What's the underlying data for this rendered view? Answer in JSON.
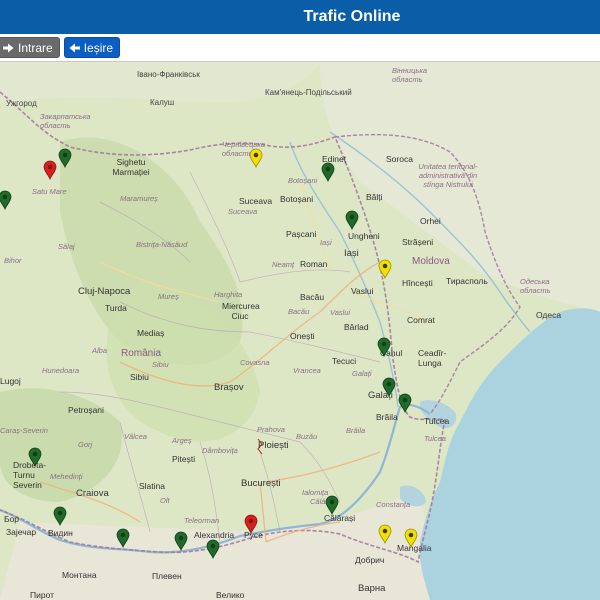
{
  "header": {
    "title": "Trafic Online"
  },
  "toolbar": {
    "login_label": "Intrare",
    "logout_label": "Ieșire"
  },
  "colors": {
    "header": "#0a5ea8",
    "marker_green": "#1f6b2a",
    "marker_yellow": "#f4e000",
    "marker_red": "#d42020",
    "sea": "#aad3df"
  },
  "map": {
    "labels": {
      "ivano": "Івано-Франківськ",
      "uzhgorod": "Ужгород",
      "kalush": "Калуш",
      "kamianets": "Кам'янець-Подільський",
      "vinnytsia": "Вінницька область",
      "zakarpatska": "Закарпатська область",
      "chernivetska": "Чернівецька область",
      "satumare": "Satu Mare",
      "sighetu": "Sighetu Marmației",
      "maramures": "Maramureș",
      "salaj": "Sălaj",
      "bihor": "Bihor",
      "bistrita": "Bistrița-Năsăud",
      "suceava_co": "Suceava",
      "suceava": "Suceava",
      "botosani_co": "Botoșani",
      "botosani": "Botoșani",
      "edinet": "Edineț",
      "soroca": "Soroca",
      "balti": "Bălți",
      "orhei": "Orhei",
      "ungheni": "Ungheni",
      "straseni": "Strășeni",
      "iasi_co": "Iași",
      "iasi": "Iași",
      "moldova": "Moldova",
      "hincesti": "Hîncești",
      "tiraspol": "Тирасполь",
      "transnistria": "Unitatea teritorial-administrativă din stînga Nistrului",
      "odessa_reg": "Одеська область",
      "odesa": "Одеса",
      "cluj": "Cluj-Napoca",
      "turda": "Turda",
      "mures": "Mureș",
      "harghita": "Harghita",
      "miercurea": "Miercurea Ciuc",
      "neamt": "Neamț",
      "roman": "Roman",
      "bacau": "Bacău",
      "bacau_co": "Bacău",
      "vaslui": "Vaslui",
      "vaslui_co": "Vaslui",
      "barlad": "Bârlad",
      "onesti": "Onești",
      "pascani": "Pașcani",
      "medias": "Mediaș",
      "romania": "România",
      "alba": "Alba",
      "sibiu": "Sibiu",
      "sibiu_co": "Sibiu",
      "covasna": "Covasna",
      "hunedoara": "Hunedoara",
      "brasov": "Brașov",
      "vrancea": "Vrancea",
      "tecuci": "Tecuci",
      "galati": "Galați",
      "galati_co": "Galați",
      "cahul": "Cahul",
      "cadir": "Ceadîr-Lunga",
      "comrat": "Comrat",
      "lugoj": "Lugoj",
      "petrosani": "Petroșani",
      "severin": "Caraș-Severin",
      "gorj": "Gorj",
      "valcea": "Vâlcea",
      "arges": "Argeș",
      "dambovita": "Dâmbovița",
      "prahova": "Prahova",
      "buzau": "Buzău",
      "braila": "Brăila",
      "braila_co": "Brăila",
      "tulcea": "Tulcea",
      "tulcea_co": "Tulcea",
      "pitesti": "Pitești",
      "ploiesti": "Ploiești",
      "drobeta": "Drobeta-Turnu Severin",
      "mehedinti": "Mehedinți",
      "craiova": "Craiova",
      "slatina": "Slatina",
      "olt": "Olt",
      "teleorman": "Teleorman",
      "bucuresti": "București",
      "ialomita": "Ialomița",
      "calarasi": "Călărași",
      "calarasi_co": "Călărași",
      "constanta": "Constanța",
      "alexandria": "Alexandria",
      "vidin": "Видин",
      "ruse": "Русе",
      "pleven": "Плевен",
      "montana": "Монтана",
      "varna": "Варна",
      "dobrich": "Добрич",
      "mangalia": "Mangalia",
      "bor": "Бор",
      "zaechar": "Зајечар",
      "pirot": "Пирот",
      "v_tarnovo": "Велико"
    }
  }
}
